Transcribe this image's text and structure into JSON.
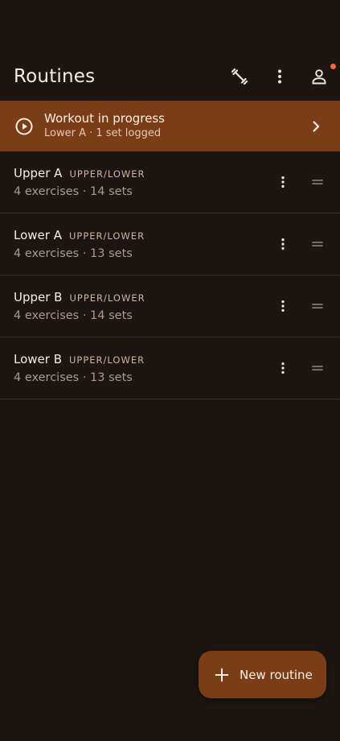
{
  "header": {
    "title": "Routines",
    "actions": [
      {
        "icon": "dumbbell-icon"
      },
      {
        "icon": "more-vert-icon"
      },
      {
        "icon": "profile-icon",
        "badge": true
      }
    ]
  },
  "banner": {
    "title": "Workout in progress",
    "subtitle": "Lower A · 1 set logged",
    "icon": "play-circle-icon",
    "color": "#7b3d17"
  },
  "routines": [
    {
      "name": "Upper A",
      "tag": "UPPER/LOWER",
      "meta": "4 exercises · 14 sets"
    },
    {
      "name": "Lower A",
      "tag": "UPPER/LOWER",
      "meta": "4 exercises · 13 sets"
    },
    {
      "name": "Upper B",
      "tag": "UPPER/LOWER",
      "meta": "4 exercises · 14 sets"
    },
    {
      "name": "Lower B",
      "tag": "UPPER/LOWER",
      "meta": "4 exercises · 13 sets"
    }
  ],
  "fab": {
    "label": "New routine",
    "icon": "plus-icon"
  },
  "colors": {
    "background": "#1c1512",
    "accent": "#7b3d17",
    "badge": "#f06a3a"
  }
}
